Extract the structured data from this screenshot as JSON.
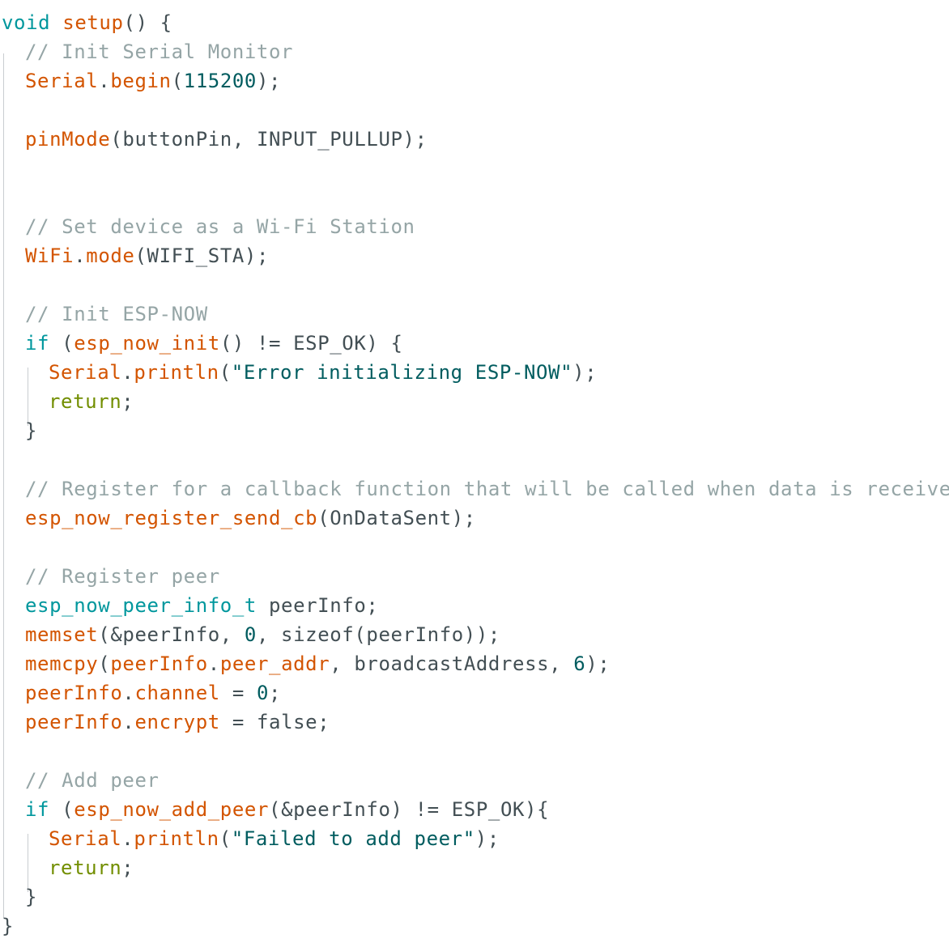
{
  "code": {
    "lines": [
      [
        {
          "c": "kw",
          "t": "void"
        },
        {
          "c": "pl",
          "t": " "
        },
        {
          "c": "fn",
          "t": "setup"
        },
        {
          "c": "pl",
          "t": "() {"
        }
      ],
      [
        {
          "c": "cm",
          "t": "// Init Serial Monitor"
        }
      ],
      [
        {
          "c": "fn",
          "t": "Serial"
        },
        {
          "c": "pl",
          "t": "."
        },
        {
          "c": "fn",
          "t": "begin"
        },
        {
          "c": "pl",
          "t": "("
        },
        {
          "c": "num",
          "t": "115200"
        },
        {
          "c": "pl",
          "t": ");"
        }
      ],
      [],
      [
        {
          "c": "fn",
          "t": "pinMode"
        },
        {
          "c": "pl",
          "t": "(buttonPin, INPUT_PULLUP);"
        }
      ],
      [],
      [],
      [
        {
          "c": "cm",
          "t": "// Set device as a Wi-Fi Station"
        }
      ],
      [
        {
          "c": "fn",
          "t": "WiFi"
        },
        {
          "c": "pl",
          "t": "."
        },
        {
          "c": "fn",
          "t": "mode"
        },
        {
          "c": "pl",
          "t": "(WIFI_STA);"
        }
      ],
      [],
      [
        {
          "c": "cm",
          "t": "// Init ESP-NOW"
        }
      ],
      [
        {
          "c": "kw",
          "t": "if"
        },
        {
          "c": "pl",
          "t": " ("
        },
        {
          "c": "fn",
          "t": "esp_now_init"
        },
        {
          "c": "pl",
          "t": "() != ESP_OK) {"
        }
      ],
      [
        {
          "c": "fn",
          "t": "Serial"
        },
        {
          "c": "pl",
          "t": "."
        },
        {
          "c": "fn",
          "t": "println"
        },
        {
          "c": "pl",
          "t": "("
        },
        {
          "c": "st",
          "t": "\"Error initializing ESP-NOW\""
        },
        {
          "c": "pl",
          "t": ");"
        }
      ],
      [
        {
          "c": "ret",
          "t": "return"
        },
        {
          "c": "pl",
          "t": ";"
        }
      ],
      [
        {
          "c": "pl",
          "t": "}"
        }
      ],
      [],
      [
        {
          "c": "cm",
          "t": "// Register for a callback function that will be called when data is received"
        }
      ],
      [
        {
          "c": "fn",
          "t": "esp_now_register_send_cb"
        },
        {
          "c": "pl",
          "t": "(OnDataSent);"
        }
      ],
      [],
      [
        {
          "c": "cm",
          "t": "// Register peer"
        }
      ],
      [
        {
          "c": "kw",
          "t": "esp_now_peer_info_t"
        },
        {
          "c": "pl",
          "t": " peerInfo;"
        }
      ],
      [
        {
          "c": "fn",
          "t": "memset"
        },
        {
          "c": "pl",
          "t": "(&peerInfo, "
        },
        {
          "c": "num",
          "t": "0"
        },
        {
          "c": "pl",
          "t": ", sizeof(peerInfo));"
        }
      ],
      [
        {
          "c": "fn",
          "t": "memcpy"
        },
        {
          "c": "pl",
          "t": "("
        },
        {
          "c": "fn",
          "t": "peerInfo"
        },
        {
          "c": "pl",
          "t": "."
        },
        {
          "c": "fn",
          "t": "peer_addr"
        },
        {
          "c": "pl",
          "t": ", broadcastAddress, "
        },
        {
          "c": "num",
          "t": "6"
        },
        {
          "c": "pl",
          "t": ");"
        }
      ],
      [
        {
          "c": "fn",
          "t": "peerInfo"
        },
        {
          "c": "pl",
          "t": "."
        },
        {
          "c": "fn",
          "t": "channel"
        },
        {
          "c": "pl",
          "t": " = "
        },
        {
          "c": "num",
          "t": "0"
        },
        {
          "c": "pl",
          "t": ";"
        }
      ],
      [
        {
          "c": "fn",
          "t": "peerInfo"
        },
        {
          "c": "pl",
          "t": "."
        },
        {
          "c": "fn",
          "t": "encrypt"
        },
        {
          "c": "pl",
          "t": " = false;"
        }
      ],
      [],
      [
        {
          "c": "cm",
          "t": "// Add peer"
        }
      ],
      [
        {
          "c": "kw",
          "t": "if"
        },
        {
          "c": "pl",
          "t": " ("
        },
        {
          "c": "fn",
          "t": "esp_now_add_peer"
        },
        {
          "c": "pl",
          "t": "(&peerInfo) != ESP_OK){"
        }
      ],
      [
        {
          "c": "fn",
          "t": "Serial"
        },
        {
          "c": "pl",
          "t": "."
        },
        {
          "c": "fn",
          "t": "println"
        },
        {
          "c": "pl",
          "t": "("
        },
        {
          "c": "st",
          "t": "\"Failed to add peer\""
        },
        {
          "c": "pl",
          "t": ");"
        }
      ],
      [
        {
          "c": "ret",
          "t": "return"
        },
        {
          "c": "pl",
          "t": ";"
        }
      ],
      [
        {
          "c": "pl",
          "t": "}"
        }
      ],
      [
        {
          "c": "pl",
          "t": "}"
        }
      ]
    ]
  },
  "theme": {
    "keyword_color": "#00979d",
    "function_color": "#d35400",
    "comment_color": "#95a5a6",
    "literal_color": "#005c5f",
    "return_color": "#728e00",
    "text_color": "#434f54"
  }
}
